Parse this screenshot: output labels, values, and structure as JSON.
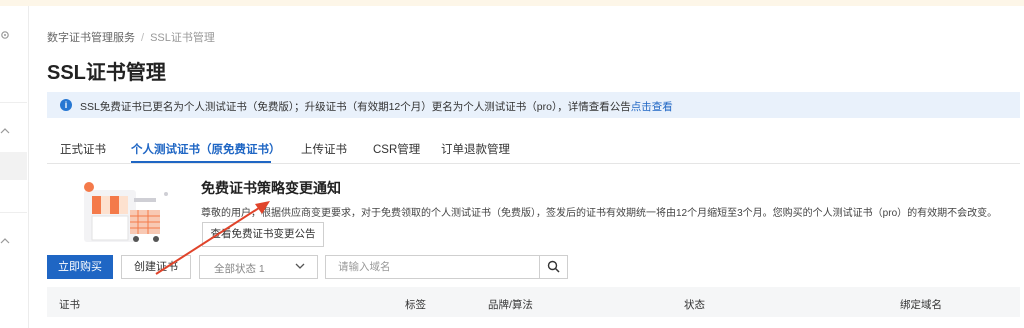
{
  "breadcrumb": {
    "parent": "数字证书管理服务",
    "separator": "/",
    "current": "SSL证书管理"
  },
  "page_title": "SSL证书管理",
  "notice": {
    "text": "SSL免费证书已更名为个人测试证书（免费版）；升级证书（有效期12个月）更名为个人测试证书（pro），详情查看公告",
    "link": "点击查看"
  },
  "tabs": [
    {
      "label": "正式证书"
    },
    {
      "label": "个人测试证书（原免费证书）"
    },
    {
      "label": "上传证书"
    },
    {
      "label": "CSR管理"
    },
    {
      "label": "订单退款管理"
    }
  ],
  "active_tab_index": 1,
  "policy": {
    "title": "免费证书策略变更通知",
    "body": "尊敬的用户，根据供应商变更要求，对于免费领取的个人测试证书（免费版），签发后的证书有效期统一将由12个月缩短至3个月。您购买的个人测试证书（pro）的有效期不会改变。",
    "button": "查看免费证书变更公告"
  },
  "toolbar": {
    "buy": "立即购买",
    "create": "创建证书",
    "status_select": "全部状态 1",
    "search_placeholder": "请输入域名"
  },
  "table": {
    "columns": [
      "证书",
      "标签",
      "品牌/算法",
      "状态",
      "绑定域名"
    ]
  },
  "colors": {
    "primary": "#1f66c4",
    "notice_bg": "#e9f1fb",
    "annotation_arrow": "#e0442b"
  },
  "icons": [
    "gear-icon",
    "chevron-up-icon",
    "info-icon",
    "chevron-down-icon",
    "search-icon",
    "shopping-cart-illustration",
    "annotation-arrow"
  ]
}
